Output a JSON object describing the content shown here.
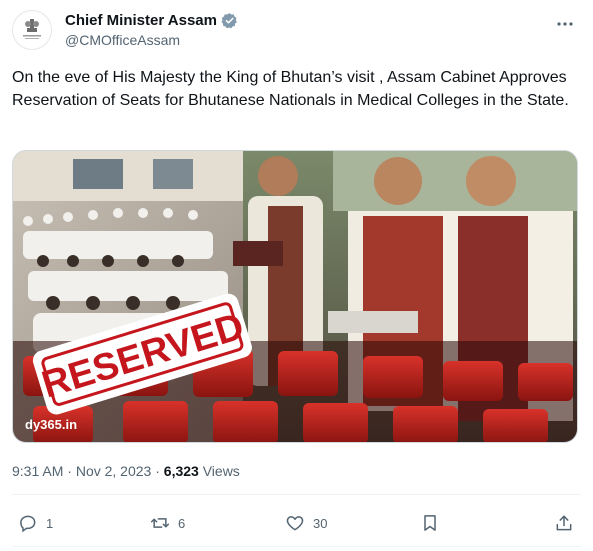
{
  "author": {
    "display_name": "Chief Minister Assam",
    "handle": "@CMOfficeAssam",
    "avatar_caption": "Government of Assam"
  },
  "tweet": {
    "text": "On the eve of His Majesty the King of Bhutan’s visit , Assam Cabinet Approves Reservation of Seats for Bhutanese Nationals in Medical Colleges in the State.",
    "media": {
      "stamp_text": "RESERVED",
      "watermark": "dy365.in"
    },
    "time": "9:31 AM",
    "separator": " · ",
    "date": "Nov 2, 2023",
    "views_count": "6,323",
    "views_label": " Views"
  },
  "actions": {
    "replies": "1",
    "reposts": "6",
    "likes": "30"
  },
  "icons": {
    "verified": "verified-badge-icon",
    "more": "more-options-icon",
    "reply": "reply-icon",
    "repost": "repost-icon",
    "like": "heart-icon",
    "bookmark": "bookmark-icon",
    "share": "share-icon"
  },
  "colors": {
    "text_primary": "#0f1419",
    "text_secondary": "#536471",
    "verified": "#829aab",
    "divider": "#eff3f4"
  }
}
